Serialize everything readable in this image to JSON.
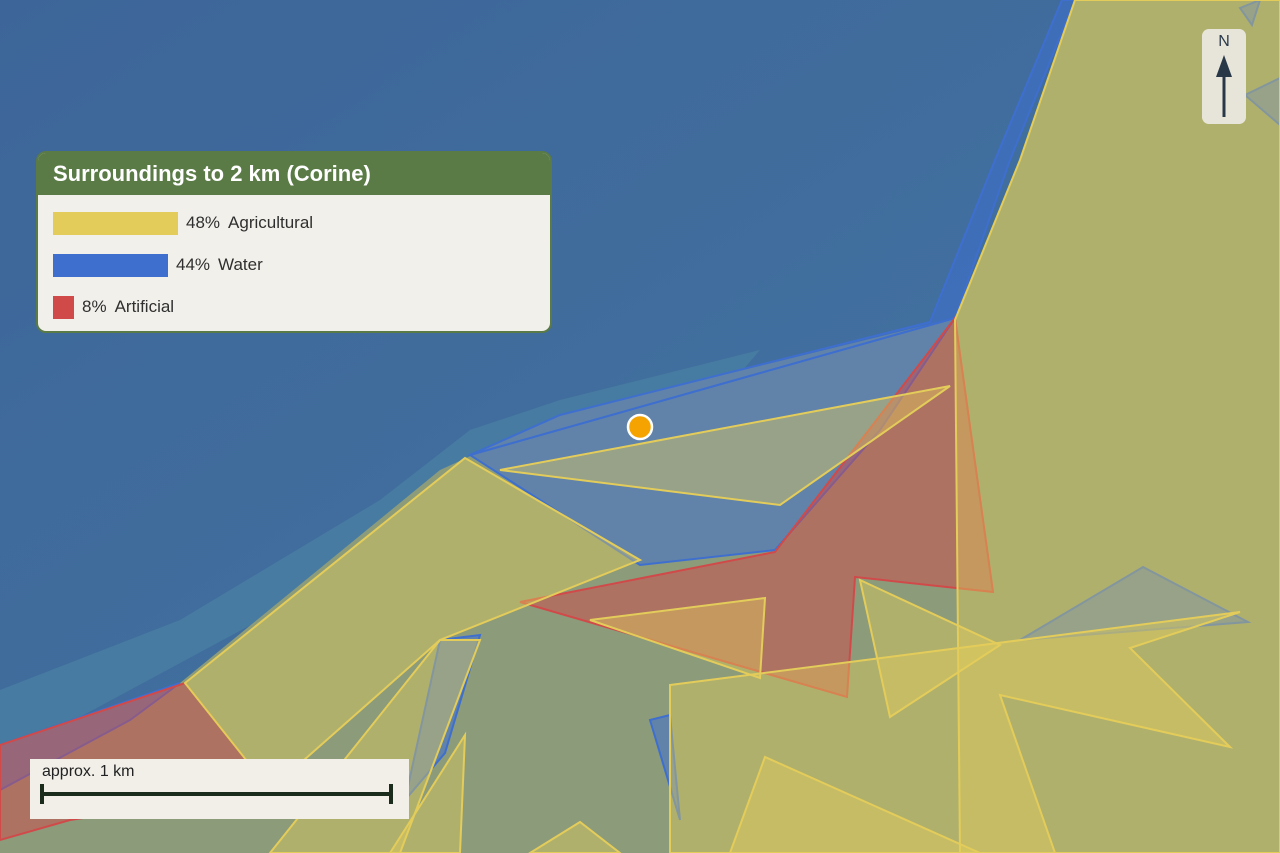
{
  "legend": {
    "title": "Surroundings to 2 km (Corine)",
    "items": [
      {
        "pct": "48%",
        "label": "Agricultural",
        "value": 48,
        "color": "#e3cc5a"
      },
      {
        "pct": "44%",
        "label": "Water",
        "value": 44,
        "color": "#3e6fcf"
      },
      {
        "pct": "8%",
        "label": "Artificial",
        "value": 8,
        "color": "#d04a4a"
      }
    ]
  },
  "north_arrow": {
    "letter": "N"
  },
  "scale_bar": {
    "label": "approx. 1 km"
  },
  "colors": {
    "sea": "#3f6a9c",
    "land": "#8a9a78",
    "agricultural": "#e3cc5a",
    "water": "#3e6fcf",
    "artificial": "#d04a4a",
    "marker": "#f5a300",
    "legend_header": "#5a7a46"
  },
  "icons": {
    "location": "location-marker-icon",
    "north": "north-arrow-icon"
  }
}
